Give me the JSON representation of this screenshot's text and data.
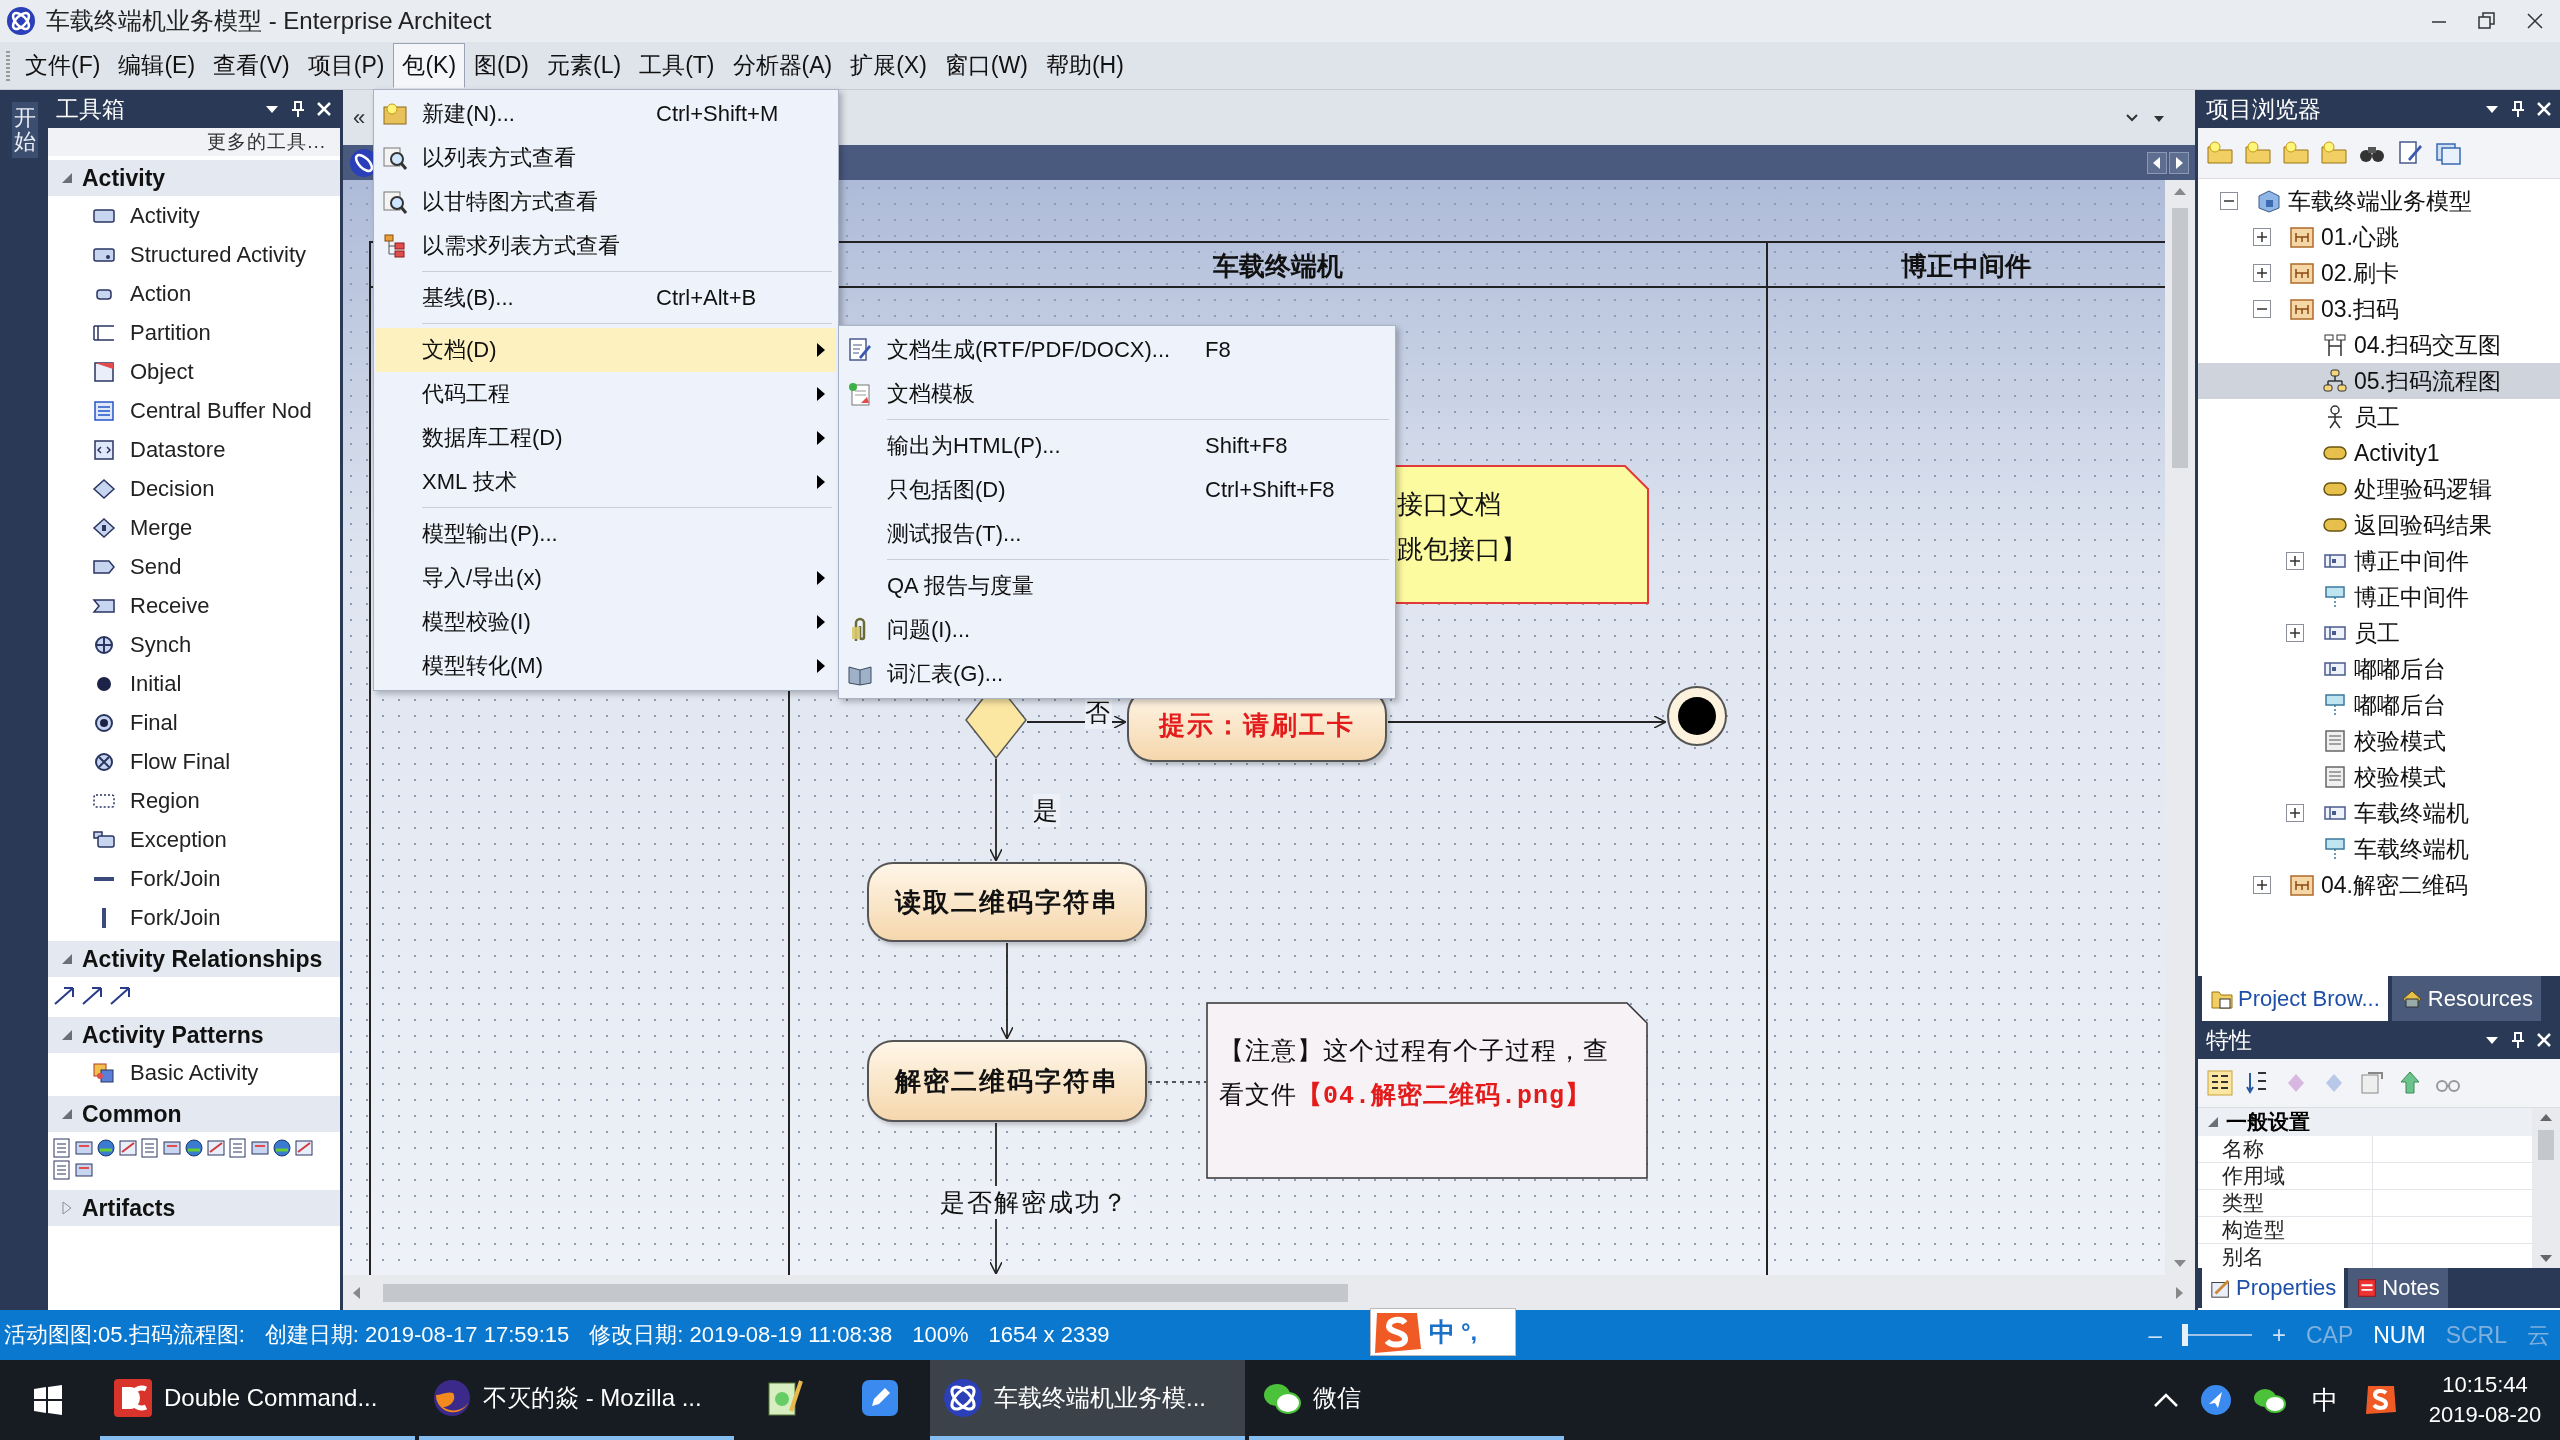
{
  "window": {
    "title": "车载终端机业务模型 - Enterprise Architect"
  },
  "menu_bar": [
    {
      "label": "文件(F)",
      "selected": false
    },
    {
      "label": "编辑(E)",
      "selected": false
    },
    {
      "label": "查看(V)",
      "selected": false
    },
    {
      "label": "项目(P)",
      "selected": false
    },
    {
      "label": "包(K)",
      "selected": true
    },
    {
      "label": "图(D)",
      "selected": false
    },
    {
      "label": "元素(L)",
      "selected": false
    },
    {
      "label": "工具(T)",
      "selected": false
    },
    {
      "label": "分析器(A)",
      "selected": false
    },
    {
      "label": "扩展(X)",
      "selected": false
    },
    {
      "label": "窗口(W)",
      "selected": false
    },
    {
      "label": "帮助(H)",
      "selected": false
    }
  ],
  "side_strip": {
    "label": "开始"
  },
  "toolbox": {
    "title": "工具箱",
    "more_tools": "更多的工具...",
    "sections": [
      {
        "label": "Activity",
        "expanded": true,
        "kind": "list",
        "items": [
          "Activity",
          "Structured Activity",
          "Action",
          "Partition",
          "Object",
          "Central Buffer Nod",
          "Datastore",
          "Decision",
          "Merge",
          "Send",
          "Receive",
          "Synch",
          "Initial",
          "Final",
          "Flow Final",
          "Region",
          "Exception",
          "Fork/Join",
          "Fork/Join"
        ]
      },
      {
        "label": "Activity Relationships",
        "expanded": true,
        "kind": "arrows"
      },
      {
        "label": "Activity Patterns",
        "expanded": true,
        "kind": "list",
        "items": [
          "Basic Activity"
        ]
      },
      {
        "label": "Common",
        "expanded": true,
        "kind": "tools"
      },
      {
        "label": "Artifacts",
        "expanded": false
      }
    ]
  },
  "editor": {
    "collapse_button": "«"
  },
  "diagram": {
    "lanes": [
      "车载终端机",
      "博正中间件"
    ],
    "actions": [
      {
        "label": "提示：请刷工卡",
        "highlight": true
      },
      {
        "label": "读取二维码字符串",
        "highlight": false
      },
      {
        "label": "解密二维码字符串",
        "highlight": false
      }
    ],
    "flow_labels": [
      "否",
      "是",
      "是否解密成功？"
    ],
    "note_1": {
      "lines": [
        "接口文档",
        "跳包接口】"
      ]
    },
    "note_2": {
      "text": "【注意】这个过程有个子过程，查看文件",
      "reference": "【04.解密二维码.png】"
    }
  },
  "package_menu": {
    "groups": [
      [
        {
          "label": "新建(N)...",
          "shortcut": "Ctrl+Shift+M",
          "kind": "new",
          "submenu": false,
          "selected": false
        },
        {
          "label": "以列表方式查看",
          "kind": "view",
          "submenu": false,
          "selected": false
        },
        {
          "label": "以甘特图方式查看",
          "kind": "view",
          "submenu": false,
          "selected": false
        },
        {
          "label": "以需求列表方式查看",
          "kind": "tree",
          "submenu": false,
          "selected": false
        }
      ],
      [
        {
          "label": "基线(B)...",
          "shortcut": "Ctrl+Alt+B",
          "kind": "plain",
          "submenu": false,
          "selected": false
        }
      ],
      [
        {
          "label": "文档(D)",
          "kind": "plain",
          "submenu": true,
          "selected": true
        },
        {
          "label": "代码工程",
          "kind": "plain",
          "submenu": true,
          "selected": false
        },
        {
          "label": "数据库工程(D)",
          "kind": "plain",
          "submenu": true,
          "selected": false
        },
        {
          "label": "XML 技术",
          "kind": "plain",
          "submenu": true,
          "selected": false
        }
      ],
      [
        {
          "label": "模型输出(P)...",
          "kind": "plain",
          "submenu": false,
          "selected": false
        },
        {
          "label": "导入/导出(x)",
          "kind": "plain",
          "submenu": true,
          "selected": false
        },
        {
          "label": "模型校验(I)",
          "kind": "plain",
          "submenu": true,
          "selected": false
        },
        {
          "label": "模型转化(M)",
          "kind": "plain",
          "submenu": true,
          "selected": false
        }
      ]
    ]
  },
  "document_submenu": {
    "groups": [
      [
        {
          "label": "文档生成(RTF/PDF/DOCX)...",
          "shortcut": "F8",
          "kind": "document",
          "selected": false
        },
        {
          "label": "文档模板",
          "kind": "template",
          "selected": false
        }
      ],
      [
        {
          "label": "输出为HTML(P)...",
          "shortcut": "Shift+F8",
          "kind": "plain",
          "selected": false
        },
        {
          "label": "只包括图(D)",
          "shortcut": "Ctrl+Shift+F8",
          "kind": "plain",
          "selected": false
        },
        {
          "label": "测试报告(T)...",
          "kind": "plain",
          "selected": false
        }
      ],
      [
        {
          "label": "QA 报告与度量",
          "kind": "plain",
          "selected": false
        },
        {
          "label": "问题(I)...",
          "kind": "issue",
          "selected": false
        },
        {
          "label": "词汇表(G)...",
          "kind": "glossary",
          "selected": false
        }
      ]
    ]
  },
  "project_browser": {
    "title": "项目浏览器",
    "tree": [
      {
        "label": "车载终端业务模型",
        "kind": "model",
        "expanded": true,
        "selected": false,
        "children": [
          {
            "label": "01.心跳",
            "kind": "package",
            "expanded": false,
            "selected": false
          },
          {
            "label": "02.刷卡",
            "kind": "package",
            "expanded": false,
            "selected": false
          },
          {
            "label": "03.扫码",
            "kind": "package",
            "expanded": true,
            "selected": false,
            "children": [
              {
                "label": "04.扫码交互图",
                "kind": "sequence-diagram",
                "selected": false
              },
              {
                "label": "05.扫码流程图",
                "kind": "activity-diagram",
                "selected": true
              },
              {
                "label": "员工",
                "kind": "actor",
                "selected": false
              },
              {
                "label": "Activity1",
                "kind": "activity",
                "selected": false
              },
              {
                "label": "处理验码逻辑",
                "kind": "activity",
                "selected": false
              },
              {
                "label": "返回验码结果",
                "kind": "activity",
                "selected": false
              },
              {
                "label": "博正中间件",
                "kind": "partition",
                "expanded": false,
                "selected": false
              },
              {
                "label": "博正中间件",
                "kind": "lifeline",
                "selected": false
              },
              {
                "label": "员工",
                "kind": "partition",
                "expanded": false,
                "selected": false
              },
              {
                "label": "嘟嘟后台",
                "kind": "partition",
                "selected": false
              },
              {
                "label": "嘟嘟后台",
                "kind": "lifeline",
                "selected": false
              },
              {
                "label": "校验模式",
                "kind": "artifact",
                "selected": false
              },
              {
                "label": "校验模式",
                "kind": "artifact",
                "selected": false
              },
              {
                "label": "车载终端机",
                "kind": "partition",
                "expanded": false,
                "selected": false
              },
              {
                "label": "车载终端机",
                "kind": "lifeline",
                "selected": false
              }
            ]
          },
          {
            "label": "04.解密二维码",
            "kind": "package",
            "expanded": false,
            "selected": false
          }
        ]
      }
    ],
    "tabs": [
      {
        "label": "Project Brow...",
        "selected": true
      },
      {
        "label": "Resources",
        "selected": false
      }
    ]
  },
  "properties": {
    "title": "特性",
    "section": {
      "label": "一般设置",
      "expanded": true
    },
    "rows": [
      "名称",
      "作用域",
      "类型",
      "构造型",
      "别名"
    ],
    "tabs": [
      {
        "label": "Properties",
        "selected": true
      },
      {
        "label": "Notes",
        "selected": false
      }
    ]
  },
  "status_bar": {
    "texts": [
      "活动图图:05.扫码流程图:",
      "创建日期: 2019-08-17 17:59:15",
      "修改日期: 2019-08-19 11:08:38",
      "100%",
      "1654 x 2339"
    ],
    "zoom_out": "–",
    "zoom": {
      "level": 0
    },
    "zoom_in": "+",
    "indicators": [
      {
        "label": "CAP",
        "on": false
      },
      {
        "label": "NUM",
        "on": true
      },
      {
        "label": "SCRL",
        "on": false
      }
    ],
    "cloud": "云"
  },
  "ime_bar": {
    "mode": "中",
    "punctuation": "°,"
  },
  "taskbar": {
    "items": [
      {
        "label": "Double Command...",
        "kind": "file-manager",
        "selected": false,
        "running": true
      },
      {
        "label": "不灭的焱 - Mozilla ...",
        "kind": "browser",
        "selected": false,
        "running": true
      },
      {
        "kind": "notepad",
        "selected": false,
        "running": false
      },
      {
        "kind": "pen",
        "selected": false,
        "running": false
      },
      {
        "label": "车载终端机业务模...",
        "kind": "app",
        "selected": true,
        "running": true
      },
      {
        "label": "微信",
        "kind": "chat",
        "selected": false,
        "running": true
      }
    ],
    "tray": {
      "language": "中",
      "time": "10:15:44",
      "date": "2019-08-20"
    }
  }
}
